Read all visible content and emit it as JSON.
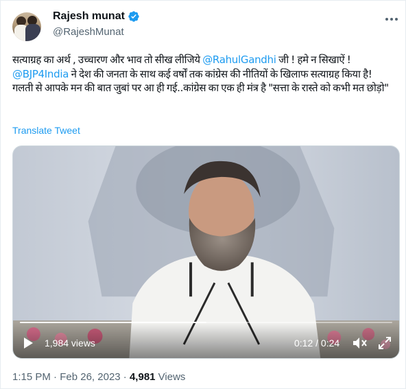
{
  "author": {
    "name": "Rajesh munat",
    "handle": "@RajeshMunat"
  },
  "tweet": {
    "line1_a": "सत्याग्रह का अर्थ , उच्चारण और भाव तो सीख लीजिये ",
    "mention1": "@RahulGandhi",
    "line1_b": " जी ! हमे न सिखाऐं ! ",
    "mention2": "@BJP4India",
    "line1_c": "  ने देश की जनता के साथ कई वर्षों तक कांग्रेस की नीतियों के खिलाफ सत्याग्रह किया है!",
    "line2": "गलती से आपके मन की बात जुबां पर आ ही गई..कांग्रेस का एक ही मंत्र है \"सत्ता के रास्ते को कभी मत छोड़ो\"",
    "translate_label": "Translate Tweet"
  },
  "video": {
    "views": "1,984 views",
    "time": "0:12 / 0:24",
    "progress": 0.5
  },
  "footer": {
    "time": "1:15 PM",
    "sep1": " · ",
    "date": "Feb 26, 2023",
    "sep2": " · ",
    "views_count": "4,981",
    "views_label": " Views"
  },
  "colors": {
    "accent": "#1d9bf0",
    "text": "#0f1419",
    "secondary": "#536471"
  },
  "icons": [
    "verified-badge-icon",
    "more-options-icon",
    "play-icon",
    "volume-icon",
    "fullscreen-icon"
  ]
}
